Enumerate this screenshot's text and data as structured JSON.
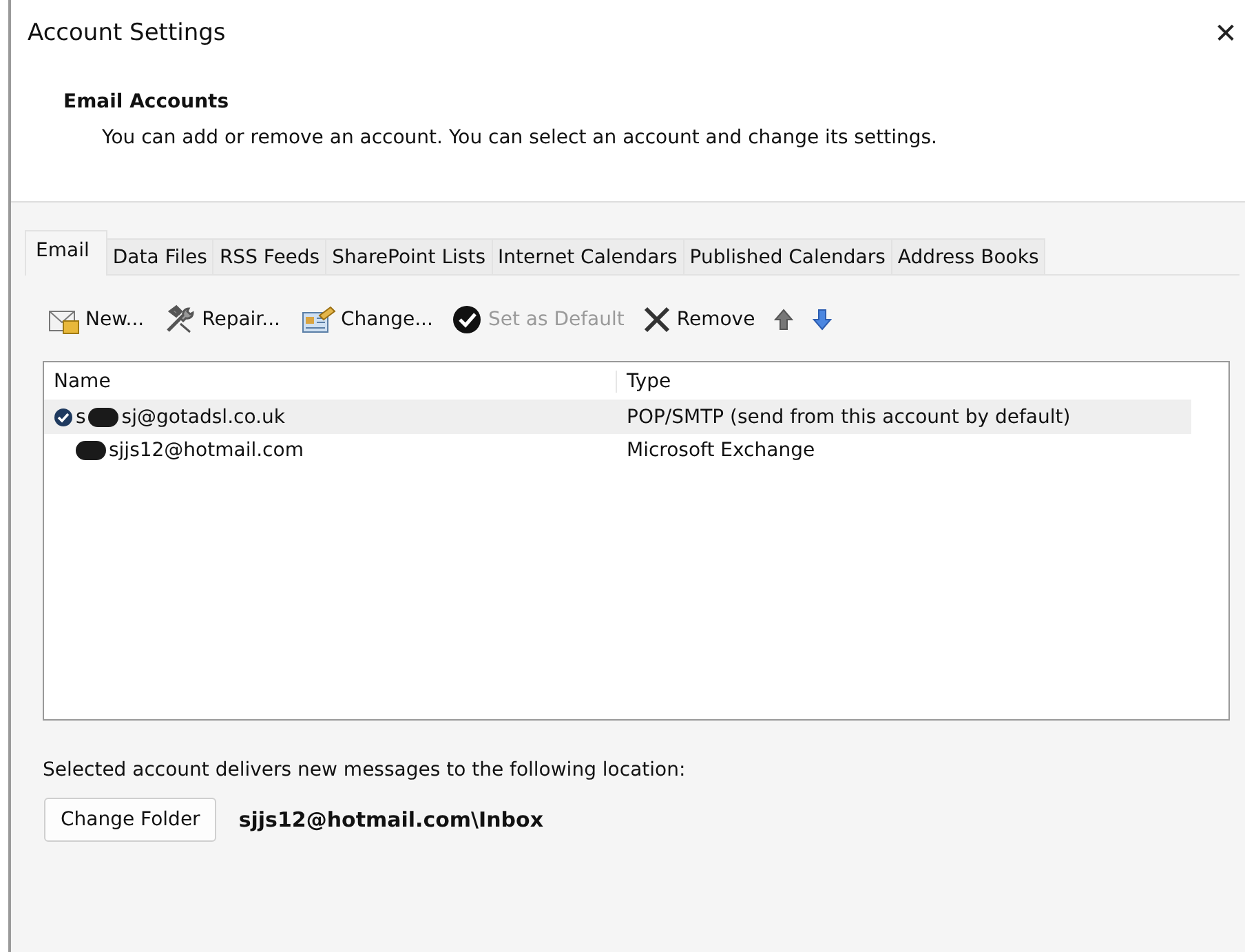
{
  "window": {
    "title": "Account Settings",
    "close": "✕"
  },
  "header": {
    "title": "Email Accounts",
    "description": "You can add or remove an account. You can select an account and change its settings."
  },
  "tabs": [
    {
      "label": "Email",
      "selected": true
    },
    {
      "label": "Data Files",
      "selected": false
    },
    {
      "label": "RSS Feeds",
      "selected": false
    },
    {
      "label": "SharePoint Lists",
      "selected": false
    },
    {
      "label": "Internet Calendars",
      "selected": false
    },
    {
      "label": "Published Calendars",
      "selected": false
    },
    {
      "label": "Address Books",
      "selected": false
    }
  ],
  "toolbar": [
    {
      "kind": "new",
      "label": "New...",
      "disabled": false
    },
    {
      "kind": "repair",
      "label": "Repair...",
      "disabled": false
    },
    {
      "kind": "change",
      "label": "Change...",
      "disabled": false
    },
    {
      "kind": "default",
      "label": "Set as Default",
      "disabled": true
    },
    {
      "kind": "remove",
      "label": "Remove",
      "disabled": false
    },
    {
      "kind": "up",
      "disabled": false
    },
    {
      "kind": "down",
      "disabled": false
    }
  ],
  "table": {
    "columns": [
      "Name",
      "Type"
    ],
    "rows": [
      {
        "name_prefix": "s",
        "name": "sj@gotadsl.co.uk",
        "type": "POP/SMTP (send from this account by default)",
        "selected": true,
        "default": true,
        "redacted": true
      },
      {
        "name": "sjjs12@hotmail.com",
        "type": "Microsoft Exchange",
        "selected": false,
        "default": false,
        "redacted": true
      }
    ]
  },
  "delivery": {
    "text": "Selected account delivers new messages to the following location:",
    "button": "Change Folder",
    "location": "sjjs12@hotmail.com\\Inbox"
  }
}
